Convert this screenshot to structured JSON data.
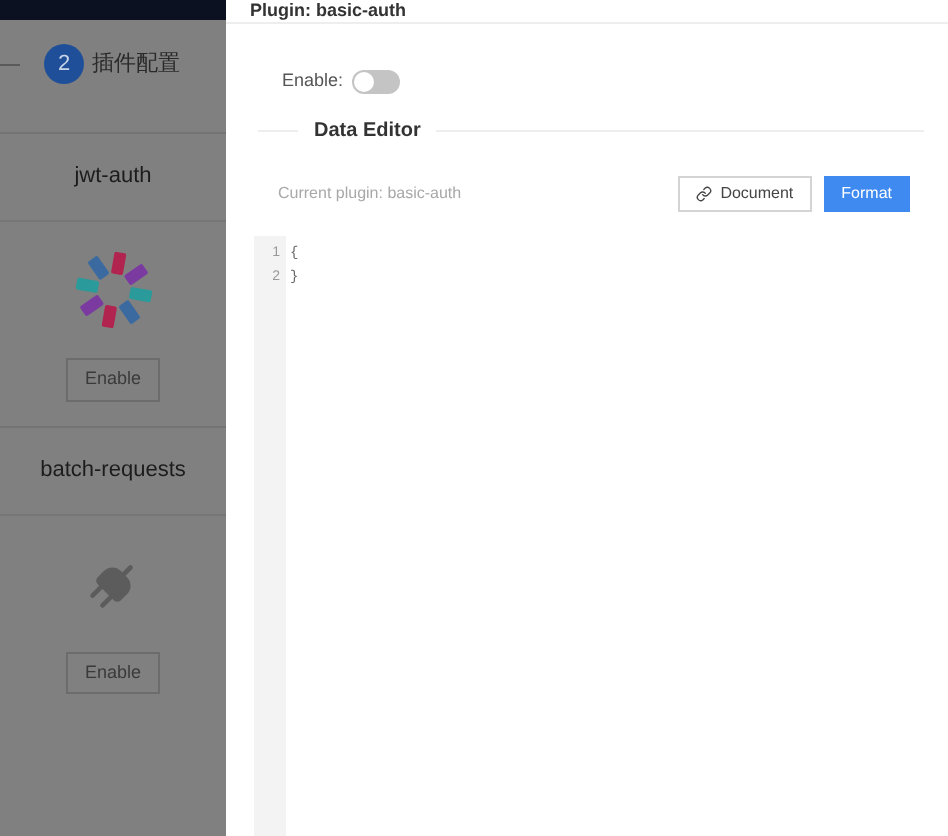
{
  "step": {
    "number": "2",
    "label": "插件配置"
  },
  "plugins": [
    {
      "name": "jwt-auth",
      "kind": "jwt",
      "button": "Enable"
    },
    {
      "name": "batch-requests",
      "kind": "plug",
      "button": "Enable"
    }
  ],
  "drawer": {
    "title": "Plugin: basic-auth",
    "enable_label": "Enable:",
    "enable_on": false,
    "section_title": "Data Editor",
    "current_plugin": "Current plugin: basic-auth",
    "document_button": "Document",
    "format_button": "Format",
    "editor_lines": [
      {
        "number": "1",
        "text": "{"
      },
      {
        "number": "2",
        "text": "}"
      }
    ]
  }
}
